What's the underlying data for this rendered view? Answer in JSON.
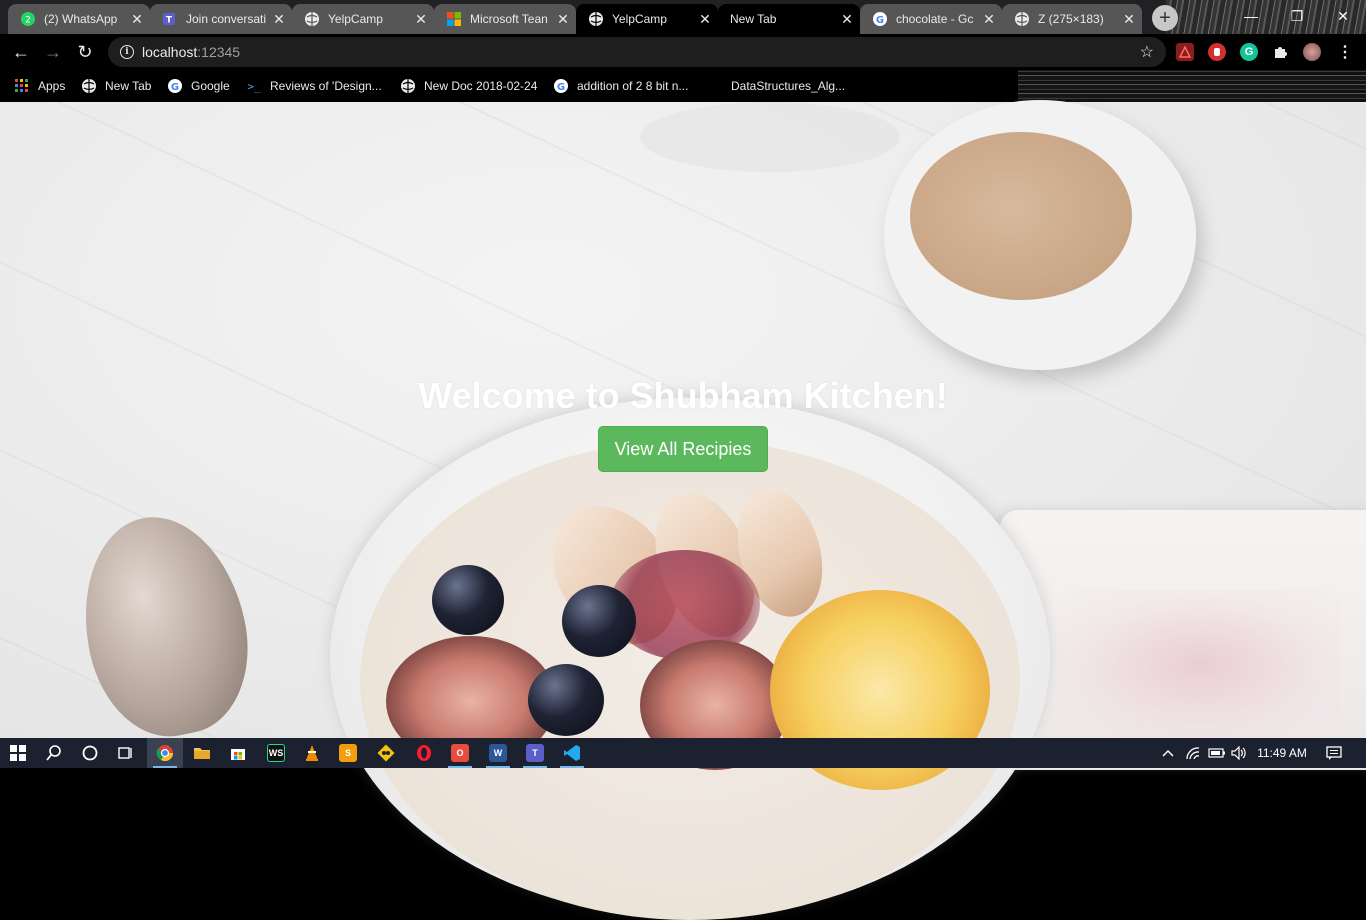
{
  "browser": {
    "tabs": [
      {
        "title": "(2) WhatsApp",
        "icon": "whatsapp-icon",
        "state": "inactive"
      },
      {
        "title": "Join conversati",
        "icon": "teams-icon",
        "state": "inactive"
      },
      {
        "title": "YelpCamp",
        "icon": "globe-icon",
        "state": "inactive"
      },
      {
        "title": "Microsoft Tean",
        "icon": "microsoft-icon",
        "state": "inactive"
      },
      {
        "title": "YelpCamp",
        "icon": "globe-icon",
        "state": "active"
      },
      {
        "title": "New Tab",
        "icon": "",
        "state": "inactive"
      },
      {
        "title": "chocolate - Gc",
        "icon": "google-icon",
        "state": "inactive"
      },
      {
        "title": "Z (275×183)",
        "icon": "globe-icon",
        "state": "inactive"
      }
    ],
    "newtab_symbol": "+",
    "window_controls": {
      "minimize": "—",
      "restore": "❐",
      "close": "✕"
    }
  },
  "toolbar": {
    "back": "←",
    "forward": "→",
    "reload": "↻",
    "info_symbol": "i",
    "url_host": "localhost",
    "url_port": ":12345",
    "star": "☆",
    "extensions": [
      {
        "name": "pdf-extension-icon",
        "color": "#e53935"
      },
      {
        "name": "adblock-extension-icon",
        "color": "#d32f2f"
      },
      {
        "name": "grammarly-extension-icon",
        "color": "#15c39a"
      },
      {
        "name": "puzzle-extensions-icon",
        "color": "#e8eaed"
      },
      {
        "name": "profile-avatar",
        "color": "#b08080"
      }
    ]
  },
  "bookmarks": [
    {
      "label": "Apps",
      "icon": "apps-grid-icon"
    },
    {
      "label": "New Tab",
      "icon": "globe-icon"
    },
    {
      "label": "Google",
      "icon": "google-icon"
    },
    {
      "label": "Reviews of 'Design...",
      "icon": "terminal-icon"
    },
    {
      "label": "New Doc 2018-02-24",
      "icon": "globe-icon"
    },
    {
      "label": "addition of 2 8 bit n...",
      "icon": "google-icon"
    },
    {
      "label": "DataStructures_Alg...",
      "icon": "blank-icon"
    }
  ],
  "page": {
    "hero_title": "Welcome to Shubham Kitchen!",
    "hero_button": "View All Recipies",
    "button_color": "#5cb85c"
  },
  "taskbar": {
    "clock": "11:49 AM",
    "apps": [
      "windows-start-icon",
      "search-icon",
      "cortana-icon",
      "task-view-icon",
      "chrome-icon",
      "file-explorer-icon",
      "store-icon",
      "webstorm-icon",
      "vlc-icon",
      "sublime-icon",
      "git-icon",
      "opera-icon",
      "office-icon",
      "onenote-icon",
      "teams-icon",
      "vscode-icon"
    ],
    "tray": [
      "chevron-up-icon",
      "wifi-icon",
      "battery-icon",
      "volume-icon",
      "notification-icon"
    ]
  }
}
